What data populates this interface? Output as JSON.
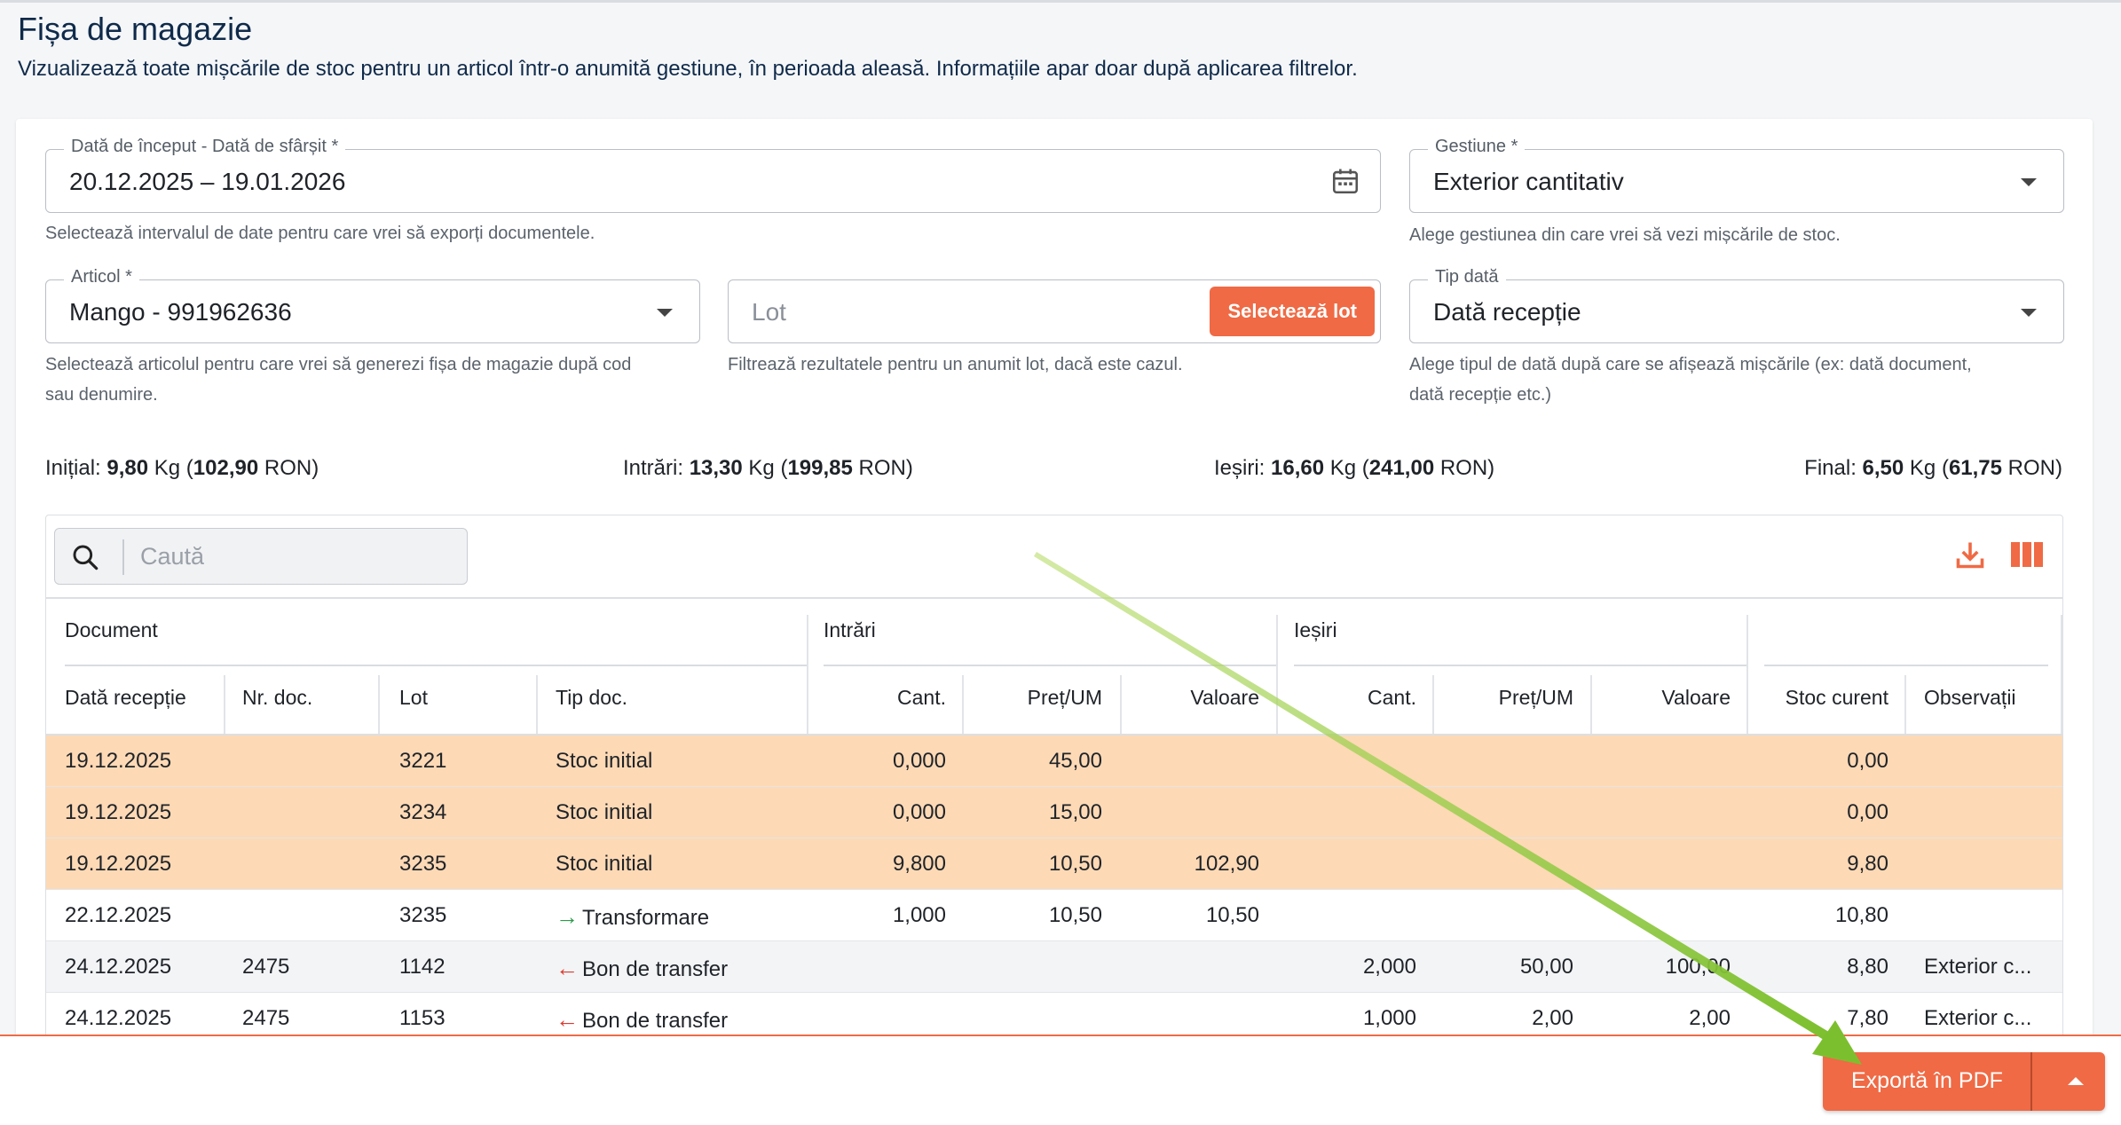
{
  "page": {
    "title": "Fișa de magazie",
    "subtitle": "Vizualizează toate mișcările de stoc pentru un articol într-o anumită gestiune, în perioada aleasă. Informațiile apar doar după aplicarea filtrelor."
  },
  "filters": {
    "date_range": {
      "label": "Dată de început - Dată de sfârșit *",
      "value": "20.12.2025 – 19.01.2026",
      "helper": "Selectează intervalul de date pentru care vrei să exporți documentele.",
      "icon": "calendar-icon"
    },
    "gestiune": {
      "label": "Gestiune *",
      "value": "Exterior cantitativ",
      "helper": "Alege gestiunea din care vrei să vezi mișcările de stoc."
    },
    "articol": {
      "label": "Articol *",
      "value": "Mango - 991962636",
      "helper_line1": "Selectează articolul pentru care vrei să generezi fișa de magazie după cod",
      "helper_line2": "sau denumire."
    },
    "lot": {
      "placeholder": "Lot",
      "button": "Selectează lot",
      "helper": "Filtrează rezultatele pentru un anumit lot, dacă este cazul."
    },
    "tip_data": {
      "label": "Tip dată",
      "value": "Dată recepție",
      "helper_line1": "Alege tipul de dată după care se afișează mișcările (ex: dată document,",
      "helper_line2": "dată recepție etc.)"
    }
  },
  "summary": {
    "initial": {
      "label": "Inițial: ",
      "qty": "9,80",
      "unit": " Kg (",
      "value": "102,90",
      "cur": " RON)"
    },
    "intrari": {
      "label": "Intrări: ",
      "qty": "13,30",
      "unit": " Kg (",
      "value": "199,85",
      "cur": " RON)"
    },
    "iesiri": {
      "label": "Ieșiri: ",
      "qty": "16,60",
      "unit": " Kg (",
      "value": "241,00",
      "cur": " RON)"
    },
    "final": {
      "label": "Final: ",
      "qty": "6,50",
      "unit": " Kg (",
      "value": "61,75",
      "cur": " RON)"
    }
  },
  "table": {
    "search_placeholder": "Caută",
    "groups": {
      "document": "Document",
      "intrari": "Intrări",
      "iesiri": "Ieșiri"
    },
    "columns": {
      "data": "Dată recepție",
      "nrdoc": "Nr. doc.",
      "lot": "Lot",
      "tip": "Tip doc.",
      "in_cant": "Cant.",
      "in_pret": "Preț/UM",
      "in_val": "Valoare",
      "out_cant": "Cant.",
      "out_pret": "Preț/UM",
      "out_val": "Valoare",
      "stoc": "Stoc curent",
      "obs": "Observații"
    },
    "rows": [
      {
        "data": "19.12.2025",
        "nrdoc": "",
        "lot": "3221",
        "tip": "Stoc initial",
        "in_cant": "0,000",
        "in_pret": "45,00",
        "in_val": "",
        "out_cant": "",
        "out_pret": "",
        "out_val": "",
        "stoc": "0,00",
        "obs": ""
      },
      {
        "data": "19.12.2025",
        "nrdoc": "",
        "lot": "3234",
        "tip": "Stoc initial",
        "in_cant": "0,000",
        "in_pret": "15,00",
        "in_val": "",
        "out_cant": "",
        "out_pret": "",
        "out_val": "",
        "stoc": "0,00",
        "obs": ""
      },
      {
        "data": "19.12.2025",
        "nrdoc": "",
        "lot": "3235",
        "tip": "Stoc initial",
        "in_cant": "9,800",
        "in_pret": "10,50",
        "in_val": "102,90",
        "out_cant": "",
        "out_pret": "",
        "out_val": "",
        "stoc": "9,80",
        "obs": ""
      },
      {
        "data": "22.12.2025",
        "nrdoc": "",
        "lot": "3235",
        "tip": "Transformare",
        "in_cant": "1,000",
        "in_pret": "10,50",
        "in_val": "10,50",
        "out_cant": "",
        "out_pret": "",
        "out_val": "",
        "stoc": "10,80",
        "obs": ""
      },
      {
        "data": "24.12.2025",
        "nrdoc": "2475",
        "lot": "1142",
        "tip": "Bon de transfer",
        "in_cant": "",
        "in_pret": "",
        "in_val": "",
        "out_cant": "2,000",
        "out_pret": "50,00",
        "out_val": "100,00",
        "stoc": "8,80",
        "obs": "Exterior c..."
      },
      {
        "data": "24.12.2025",
        "nrdoc": "2475",
        "lot": "1153",
        "tip": "Bon de transfer",
        "in_cant": "",
        "in_pret": "",
        "in_val": "",
        "out_cant": "1,000",
        "out_pret": "2,00",
        "out_val": "2,00",
        "stoc": "7,80",
        "obs": "Exterior c..."
      }
    ]
  },
  "footer": {
    "export_label": "Exportă în PDF"
  },
  "colors": {
    "accent": "#ef6a45",
    "initial_row": "#fdd9b5",
    "in_arrow": "#2e9a4a",
    "out_arrow": "#d93a2f",
    "annotation_arrow": "#8cc63f"
  }
}
